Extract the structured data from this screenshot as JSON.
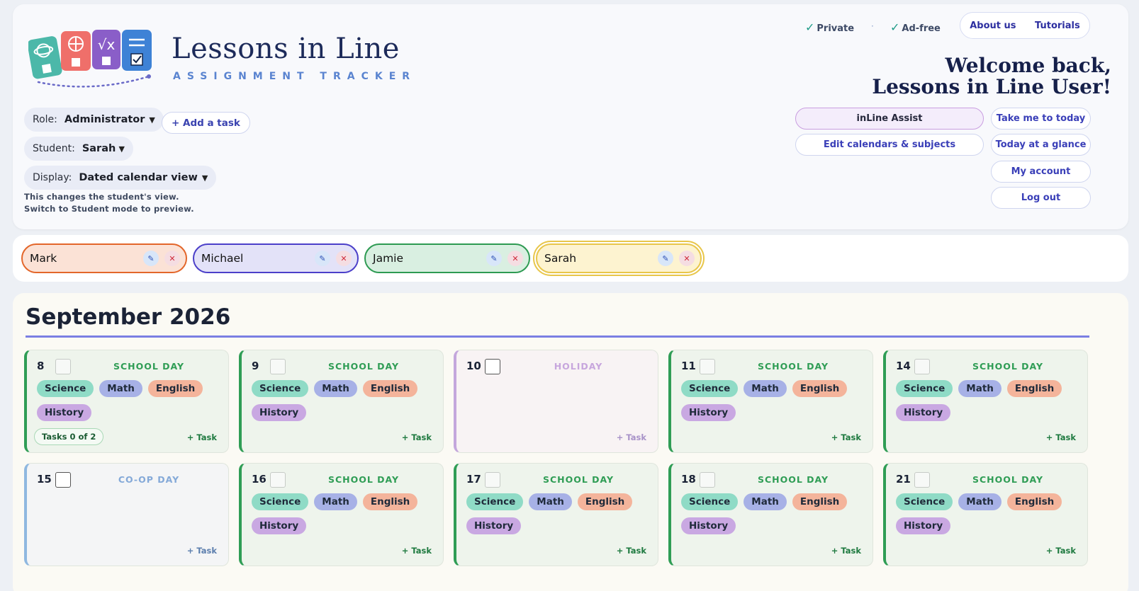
{
  "brand": {
    "title": "Lessons in Line",
    "subtitle": "ASSIGNMENT TRACKER"
  },
  "badges": [
    {
      "label": "Private"
    },
    {
      "label": "Ad-free"
    }
  ],
  "nav": {
    "about": "About us",
    "tutorials": "Tutorials"
  },
  "welcome": {
    "line1": "Welcome back,",
    "line2": "Lessons in Line User!"
  },
  "controls": {
    "role_label": "Role:",
    "role_value": "Administrator",
    "add_task": "+ Add a task",
    "student_label": "Student:",
    "student_value": "Sarah",
    "display_label": "Display:",
    "display_value": "Dated calendar view",
    "hint1": "This changes the student's view.",
    "hint2": "Switch to Student mode to preview."
  },
  "actions": {
    "assist": "inLine Assist",
    "edit_calendars": "Edit calendars & subjects",
    "today": "Take me to today",
    "glance": "Today at a glance",
    "account": "My account",
    "logout": "Log out"
  },
  "students": [
    {
      "name": "Mark",
      "bg": "#fbe2d6",
      "border": "#e3662a"
    },
    {
      "name": "Michael",
      "bg": "#e3e2f8",
      "border": "#4b3fc9"
    },
    {
      "name": "Jamie",
      "bg": "#d9efe1",
      "border": "#2d9a52"
    },
    {
      "name": "Sarah",
      "bg": "#fdf3d0",
      "border": "#e8c64a"
    }
  ],
  "calendar": {
    "month": "September 2026",
    "add_task_label": "+ Task",
    "tasks_badge": "Tasks 0 of 2",
    "subjects": [
      "Science",
      "Math",
      "English",
      "History"
    ],
    "days": [
      {
        "num": "8",
        "type": "SCHOOL DAY"
      },
      {
        "num": "9",
        "type": "SCHOOL DAY"
      },
      {
        "num": "10",
        "type": "HOLIDAY"
      },
      {
        "num": "11",
        "type": "SCHOOL DAY"
      },
      {
        "num": "14",
        "type": "SCHOOL DAY"
      },
      {
        "num": "15",
        "type": "CO-OP DAY"
      },
      {
        "num": "16",
        "type": "SCHOOL DAY"
      },
      {
        "num": "17",
        "type": "SCHOOL DAY"
      },
      {
        "num": "18",
        "type": "SCHOOL DAY"
      },
      {
        "num": "21",
        "type": "SCHOOL DAY"
      }
    ]
  }
}
